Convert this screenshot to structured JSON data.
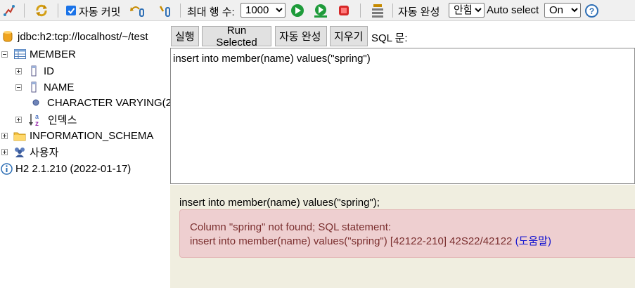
{
  "toolbar": {
    "autocommit_label": "자동 커밋",
    "autocommit_checked": true,
    "max_rows_label": "최대 행 수:",
    "max_rows_value": "1000",
    "autocomplete_label": "자동 완성",
    "autocomplete_value": "안함",
    "autoselect_label": "Auto select",
    "autoselect_value": "On"
  },
  "tree": {
    "connection": "jdbc:h2:tcp://localhost/~/test",
    "table": "MEMBER",
    "columns": [
      {
        "name": "ID"
      },
      {
        "name": "NAME",
        "type": "CHARACTER VARYING(2"
      }
    ],
    "indexes_label": "인덱스",
    "schema": "INFORMATION_SCHEMA",
    "users_label": "사용자",
    "version": "H2 2.1.210 (2022-01-17)"
  },
  "sql_toolbar": {
    "run": "실행",
    "run_selected": "Run Selected",
    "auto_complete": "자동 완성",
    "clear": "지우기",
    "sql_label": "SQL 문:"
  },
  "editor": {
    "text": "insert into member(name) values(\"spring\")"
  },
  "result": {
    "statement": "insert into member(name) values(\"spring\");",
    "error_line1": "Column \"spring\" not found; SQL statement:",
    "error_line2": "insert into member(name) values(\"spring\") [42122-210] 42S22/42122",
    "help_link": "(도움말)"
  },
  "colors": {
    "error_bg": "#eecfd0",
    "error_text": "#7a2e2e",
    "result_bg": "#f0eee0",
    "link": "#1515d0"
  }
}
